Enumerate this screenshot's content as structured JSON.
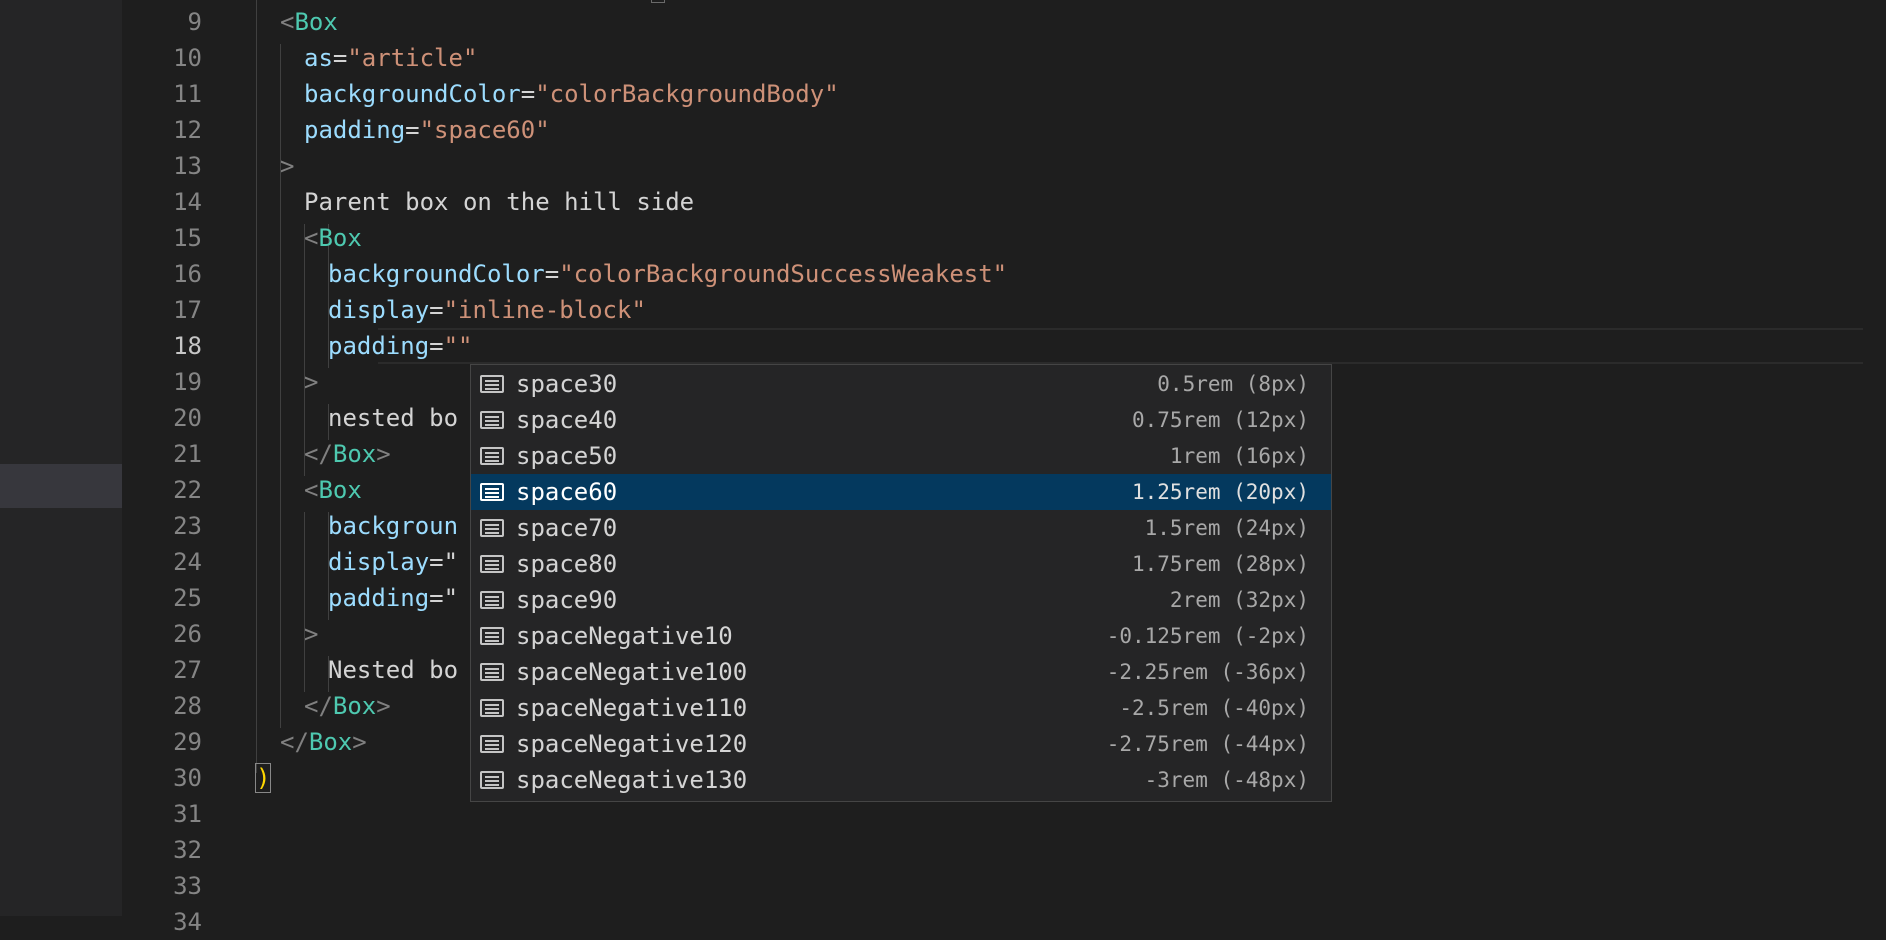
{
  "editor": {
    "lines": [
      {
        "num": "9",
        "segments": [
          [
            "punc",
            "<"
          ],
          [
            "tag",
            "Box"
          ]
        ]
      },
      {
        "num": "10",
        "segments": [
          [
            "attr",
            "as"
          ],
          [
            "eq",
            "="
          ],
          [
            "str",
            "\"article\""
          ]
        ]
      },
      {
        "num": "11",
        "segments": [
          [
            "attr",
            "backgroundColor"
          ],
          [
            "eq",
            "="
          ],
          [
            "str",
            "\"colorBackgroundBody\""
          ]
        ]
      },
      {
        "num": "12",
        "segments": [
          [
            "attr",
            "padding"
          ],
          [
            "eq",
            "="
          ],
          [
            "str",
            "\"space60\""
          ]
        ]
      },
      {
        "num": "13",
        "segments": [
          [
            "punc",
            ">"
          ]
        ]
      },
      {
        "num": "14",
        "segments": [
          [
            "txt",
            "Parent box on the hill side"
          ]
        ]
      },
      {
        "num": "15",
        "segments": [
          [
            "punc",
            "<"
          ],
          [
            "tag",
            "Box"
          ]
        ]
      },
      {
        "num": "16",
        "segments": [
          [
            "attr",
            "backgroundColor"
          ],
          [
            "eq",
            "="
          ],
          [
            "str",
            "\"colorBackgroundSuccessWeakest\""
          ]
        ]
      },
      {
        "num": "17",
        "segments": [
          [
            "attr",
            "display"
          ],
          [
            "eq",
            "="
          ],
          [
            "str",
            "\"inline-block\""
          ]
        ]
      },
      {
        "num": "18",
        "segments": [
          [
            "attr",
            "padding"
          ],
          [
            "eq",
            "="
          ],
          [
            "str",
            "\"\""
          ]
        ]
      },
      {
        "num": "19",
        "segments": [
          [
            "punc",
            ">"
          ]
        ]
      },
      {
        "num": "20",
        "segments": [
          [
            "txt",
            "nested bo"
          ]
        ]
      },
      {
        "num": "21",
        "segments": [
          [
            "punc",
            "</"
          ],
          [
            "tag",
            "Box"
          ],
          [
            "punc",
            ">"
          ]
        ]
      },
      {
        "num": "22",
        "segments": [
          [
            "punc",
            "<"
          ],
          [
            "tag",
            "Box"
          ]
        ]
      },
      {
        "num": "23",
        "segments": [
          [
            "attr",
            "backgroun"
          ]
        ]
      },
      {
        "num": "24",
        "segments": [
          [
            "attr",
            "display"
          ],
          [
            "eq",
            "=\""
          ]
        ]
      },
      {
        "num": "25",
        "segments": [
          [
            "attr",
            "padding"
          ],
          [
            "eq",
            "=\""
          ]
        ]
      },
      {
        "num": "26",
        "segments": [
          [
            "punc",
            ">"
          ]
        ]
      },
      {
        "num": "27",
        "segments": [
          [
            "txt",
            "Nested bo"
          ]
        ]
      },
      {
        "num": "28",
        "segments": [
          [
            "punc",
            "</"
          ],
          [
            "tag",
            "Box"
          ],
          [
            "punc",
            ">"
          ]
        ]
      },
      {
        "num": "29",
        "segments": [
          [
            "punc",
            "</"
          ],
          [
            "tag",
            "Box"
          ],
          [
            "punc",
            ">"
          ]
        ]
      },
      {
        "num": "30",
        "segments": [
          [
            "brace",
            ")"
          ]
        ]
      },
      {
        "num": "31",
        "segments": []
      },
      {
        "num": "32",
        "segments": []
      },
      {
        "num": "33",
        "segments": []
      },
      {
        "num": "34",
        "segments": []
      }
    ],
    "current_line": "18"
  },
  "suggest": {
    "items": [
      {
        "label": "space30",
        "detail": "0.5rem (8px)"
      },
      {
        "label": "space40",
        "detail": "0.75rem (12px)"
      },
      {
        "label": "space50",
        "detail": "1rem (16px)"
      },
      {
        "label": "space60",
        "detail": "1.25rem (20px)"
      },
      {
        "label": "space70",
        "detail": "1.5rem (24px)"
      },
      {
        "label": "space80",
        "detail": "1.75rem (28px)"
      },
      {
        "label": "space90",
        "detail": "2rem (32px)"
      },
      {
        "label": "spaceNegative10",
        "detail": "-0.125rem (-2px)"
      },
      {
        "label": "spaceNegative100",
        "detail": "-2.25rem (-36px)"
      },
      {
        "label": "spaceNegative110",
        "detail": "-2.5rem (-40px)"
      },
      {
        "label": "spaceNegative120",
        "detail": "-2.75rem (-44px)"
      },
      {
        "label": "spaceNegative130",
        "detail": "-3rem (-48px)"
      }
    ],
    "selected": "space60",
    "item_icon": "enum-member-icon"
  },
  "colors": {
    "background": "#1e1e1e",
    "tag": "#4ec9b0",
    "attribute": "#9cdcfe",
    "string": "#ce9178",
    "selection": "#04395e"
  }
}
